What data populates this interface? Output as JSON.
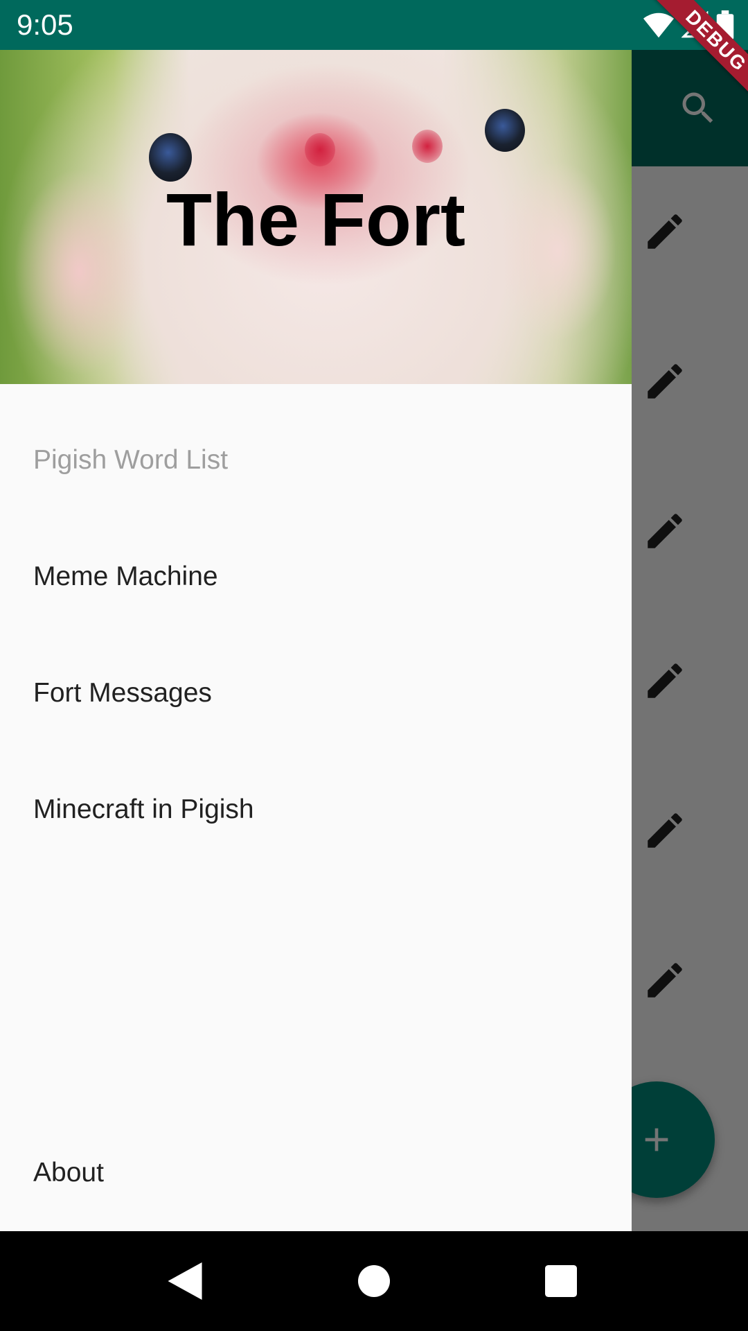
{
  "status_bar": {
    "time": "9:05",
    "icons": [
      "wifi-icon",
      "cell-signal-icon",
      "battery-icon"
    ]
  },
  "app_bar": {
    "actions": [
      "search-icon"
    ],
    "background": "#00695c"
  },
  "list": {
    "row_actions": [
      "edit-icon",
      "edit-icon",
      "edit-icon",
      "edit-icon",
      "edit-icon",
      "edit-icon"
    ]
  },
  "fab": {
    "icon": "add-icon",
    "color": "#00897b"
  },
  "drawer": {
    "title": "The Fort",
    "items": [
      {
        "label": "Pigish Word List",
        "enabled": false
      },
      {
        "label": "Meme Machine",
        "enabled": true
      },
      {
        "label": "Fort Messages",
        "enabled": true
      },
      {
        "label": "Minecraft in Pigish",
        "enabled": true
      }
    ],
    "footer_item": {
      "label": "About"
    }
  },
  "debug_banner": "DEBUG",
  "nav_bar": {
    "buttons": [
      "back-icon",
      "home-icon",
      "recents-icon"
    ]
  }
}
